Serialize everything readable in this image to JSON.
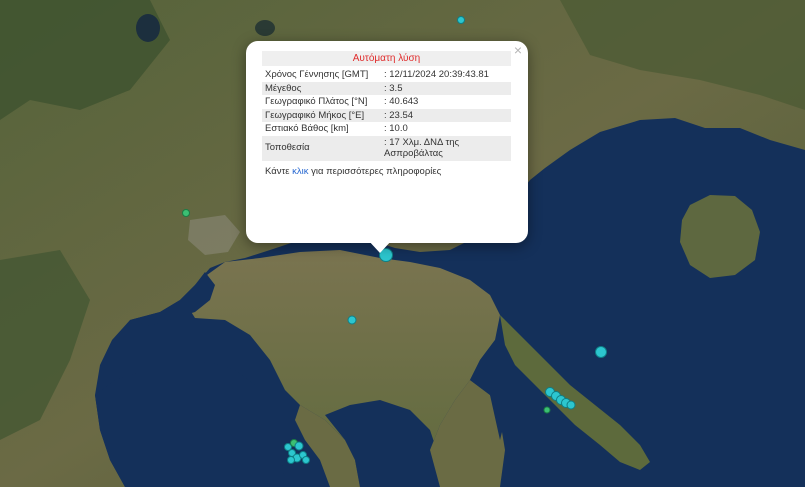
{
  "popup": {
    "title": "Αυτόματη λύση",
    "close_symbol": "×",
    "rows": [
      {
        "label": "Χρόνος Γέννησης [GMT]",
        "value": ": 12/11/2024 20:39:43.81"
      },
      {
        "label": "Μέγεθος",
        "value": ": 3.5"
      },
      {
        "label": "Γεωγραφικό Πλάτος [°N]",
        "value": ": 40.643"
      },
      {
        "label": "Γεωγραφικό Μήκος [°E]",
        "value": ": 23.54"
      },
      {
        "label": "Εστιακό Βάθος [km]",
        "value": ": 10.0"
      },
      {
        "label": "Τοποθεσία",
        "value": ": 17 Χλμ. ΔΝΔ της Ασπροβάλτας"
      }
    ],
    "more_prefix": "Κάντε ",
    "more_link": "κλικ",
    "more_suffix": " για περισσότερες πληροφορίες"
  },
  "colors": {
    "marker_cyan": "#2cc6cf",
    "marker_green": "#3cbf73",
    "title_red": "#e02b2b",
    "link_blue": "#2a6ad1"
  }
}
